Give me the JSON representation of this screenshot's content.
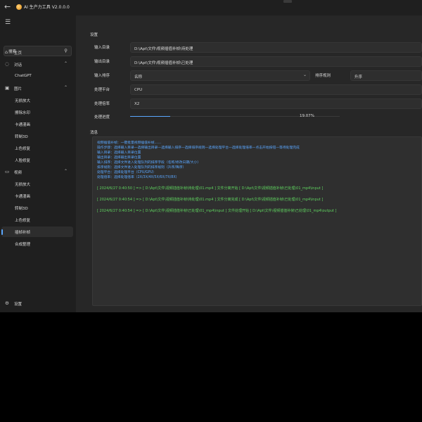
{
  "titlebar": {
    "back_icon": "arrow-left-icon",
    "title": "AI 生产力工具 V2.0.0.0"
  },
  "sidebar": {
    "search_placeholder": "搜索",
    "items": [
      {
        "label": "主页",
        "icon": "home-icon"
      },
      {
        "label": "对话",
        "icon": "chat-icon"
      },
      {
        "label": "ChatGPT"
      },
      {
        "label": "图片",
        "icon": "image-icon"
      },
      {
        "label": "无损放大"
      },
      {
        "label": "擦除水印"
      },
      {
        "label": "卡通漫画"
      },
      {
        "label": "转制3D"
      },
      {
        "label": "上色修复"
      },
      {
        "label": "人脸修复"
      },
      {
        "label": "视频",
        "icon": "video-icon"
      },
      {
        "label": "无损放大"
      },
      {
        "label": "卡通漫画"
      },
      {
        "label": "转制3D"
      },
      {
        "label": "上色修复"
      },
      {
        "label": "插帧补帧"
      },
      {
        "label": "合成整理"
      }
    ],
    "settings_label": "设置"
  },
  "settings": {
    "section_title": "设置",
    "input_dir_label": "输入目录",
    "input_dir_value": "D:\\Apt\\文件\\视频插值补帧\\待处理",
    "output_dir_label": "输出目录",
    "output_dir_value": "D:\\Apt\\文件\\视频插值补帧\\已处理",
    "sort_label": "输入排序",
    "sort_value": "名称",
    "sort_rule_label": "排序规则",
    "sort_rule_value": "升序",
    "platform_label": "处理平台",
    "platform_value": "CPU",
    "multiplier_label": "处理倍率",
    "multiplier_value": "X2",
    "progress_label": "处理进度",
    "progress_value": 19.07,
    "progress_text": "19.07%"
  },
  "messages": {
    "section_title": "消息",
    "info_lines": [
      "视频插值补帧：一键批量视频插值补帧……",
      "操作步骤：选择输入目录—选择输出目录—选择输入排序—选择排序规则—选择处理平台—选择处理倍率—点击开始按钮—等待处理完成",
      "输入目录：选择输入目录位置",
      "输出目录：选择输出目录位置",
      "输入排序：选择文件进入处理队列的排序字段（名称/修改日期/大小）",
      "排序规则：选择文件进入处理队列的排序规则（升序/降序）",
      "处理平台：选择处理平台（CPU/GPU）",
      "处理倍率：选择处理倍率（2X/3X/4X/5X/6X/7X/8X）"
    ],
    "log_lines": [
      "[ 2024/6/27 0:40:50 ] => [ D:\\Apt\\文件\\视频插值补帧\\待处理\\01.mp4 ] 文件分离开始 [ D:\\Apt\\文件\\视频插值补帧\\已处理\\01_mp4\\input ]",
      "[ 2024/6/27 0:40:54 ] => [ D:\\Apt\\文件\\视频插值补帧\\待处理\\01.mp4 ] 文件分离完成 [ D:\\Apt\\文件\\视频插值补帧\\已处理\\01_mp4\\input ]",
      "[ 2024/6/27 0:40:54 ] => [ D:\\Apt\\文件\\视频插值补帧\\已处理\\01_mp4\\input ] 文件处理开始 [ D:\\Apt\\文件\\视频插值补帧\\已处理\\01_mp4\\output ]"
    ]
  },
  "colors": {
    "accent": "#5aa7ff",
    "log_success": "#5fd35f",
    "sidebar_bg": "#1f1f1f",
    "content_bg": "#272727"
  }
}
